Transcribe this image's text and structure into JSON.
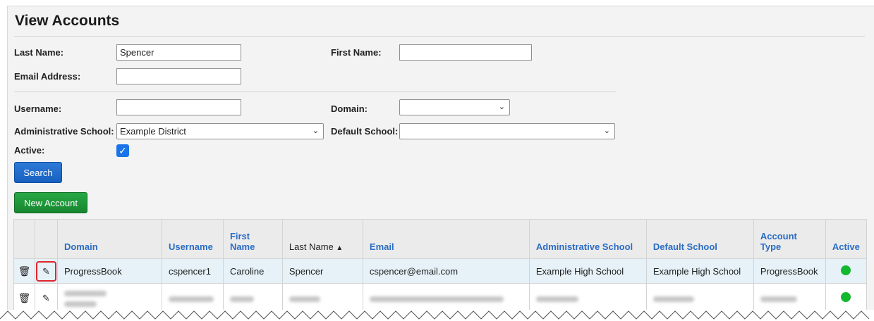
{
  "page": {
    "title": "View Accounts"
  },
  "filters": {
    "last_name": {
      "label": "Last Name:",
      "value": "Spencer"
    },
    "first_name": {
      "label": "First Name:",
      "value": ""
    },
    "email": {
      "label": "Email Address:",
      "value": ""
    },
    "username": {
      "label": "Username:",
      "value": ""
    },
    "domain": {
      "label": "Domain:",
      "value": ""
    },
    "admin_school": {
      "label": "Administrative School:",
      "value": "Example District"
    },
    "default_school": {
      "label": "Default School:",
      "value": ""
    },
    "active": {
      "label": "Active:",
      "checked": true
    }
  },
  "buttons": {
    "search": "Search",
    "new_account": "New Account"
  },
  "table": {
    "headers": {
      "domain": "Domain",
      "username": "Username",
      "first_name": "First Name",
      "last_name": "Last Name",
      "sort_indicator": "▲",
      "email": "Email",
      "admin_school": "Administrative School",
      "default_school": "Default School",
      "account_type_1": "Account",
      "account_type_2": "Type",
      "active": "Active"
    },
    "rows": [
      {
        "domain": "ProgressBook",
        "username": "cspencer1",
        "first_name": "Caroline",
        "last_name": "Spencer",
        "email": "cspencer@email.com",
        "admin_school": "Example High School",
        "default_school": "Example High School",
        "account_type": "ProgressBook",
        "active": true
      }
    ]
  },
  "icons": {
    "delete": "trash-icon",
    "edit": "pencil-icon",
    "active_color": "#12b82e",
    "highlight_color": "#e0262b"
  }
}
